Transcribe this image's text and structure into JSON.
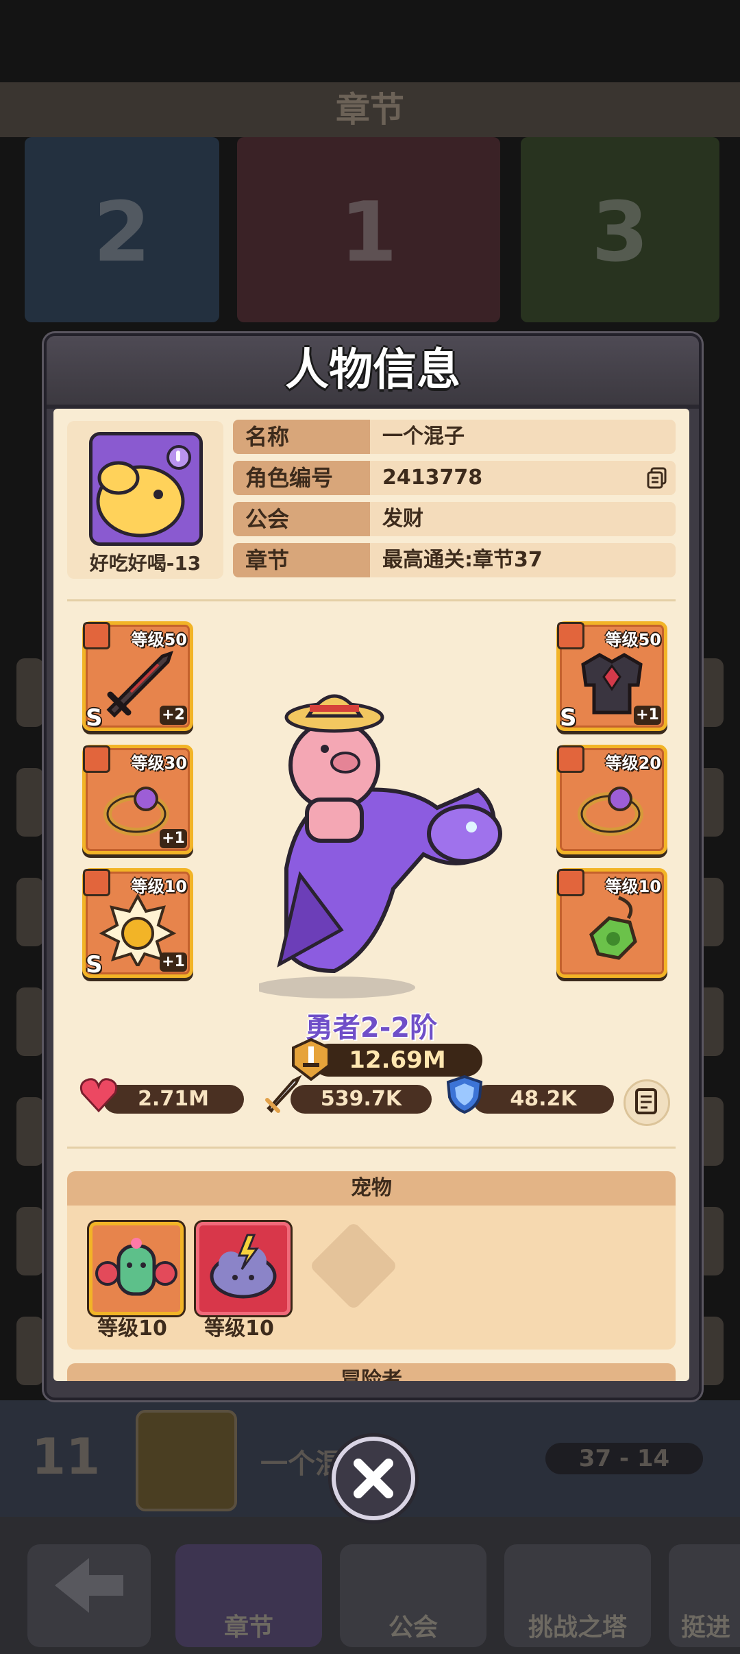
{
  "background": {
    "screen_title": "章节",
    "chapters": [
      "2",
      "1",
      "3"
    ],
    "rank_row": {
      "rank": "11",
      "player_name": "一个混",
      "score": "37 - 14"
    },
    "bottom_nav": [
      "章节",
      "公会",
      "挑战之塔",
      "挺进"
    ]
  },
  "modal": {
    "title": "人物信息",
    "avatar_name": "好吃好喝-13",
    "info": [
      {
        "key": "名称",
        "value": "一个混子"
      },
      {
        "key": "角色编号",
        "value": "2413778"
      },
      {
        "key": "公会",
        "value": "发财"
      },
      {
        "key": "章节",
        "value": "最高通关:章节37"
      }
    ],
    "equipment_left": [
      {
        "slot": "weapon",
        "level": "等级50",
        "grade": "S",
        "plus": "+2",
        "icon": "dark-sword-icon"
      },
      {
        "slot": "ring",
        "level": "等级30",
        "grade": "",
        "plus": "+1",
        "icon": "purple-ring-icon"
      },
      {
        "slot": "necklace",
        "level": "等级10",
        "grade": "S",
        "plus": "+1",
        "icon": "sun-amulet-icon"
      }
    ],
    "equipment_right": [
      {
        "slot": "armor",
        "level": "等级50",
        "grade": "S",
        "plus": "+1",
        "icon": "dark-armor-icon"
      },
      {
        "slot": "ring",
        "level": "等级20",
        "grade": "",
        "plus": "",
        "icon": "purple-ring-icon"
      },
      {
        "slot": "necklace",
        "level": "等级10",
        "grade": "",
        "plus": "",
        "icon": "green-pendant-icon"
      }
    ],
    "hero_rank": "勇者2-2阶",
    "power": "12.69M",
    "stats": {
      "hp": "2.71M",
      "attack": "539.7K",
      "defense": "48.2K"
    },
    "pets_section": {
      "title": "宠物",
      "pets": [
        {
          "level": "等级10",
          "icon": "cactus-boxer-pet-icon"
        },
        {
          "level": "等级10",
          "icon": "storm-cloud-pet-icon"
        }
      ]
    },
    "adventurer_section": {
      "title": "冒险者"
    }
  },
  "colors": {
    "modal_frame": "#3e3b44",
    "parchment": "#f9ecd3",
    "equip_orange": "#e7844c",
    "equip_gold_border": "#f2b427",
    "hero_rank_purple": "#6f4fc8"
  }
}
